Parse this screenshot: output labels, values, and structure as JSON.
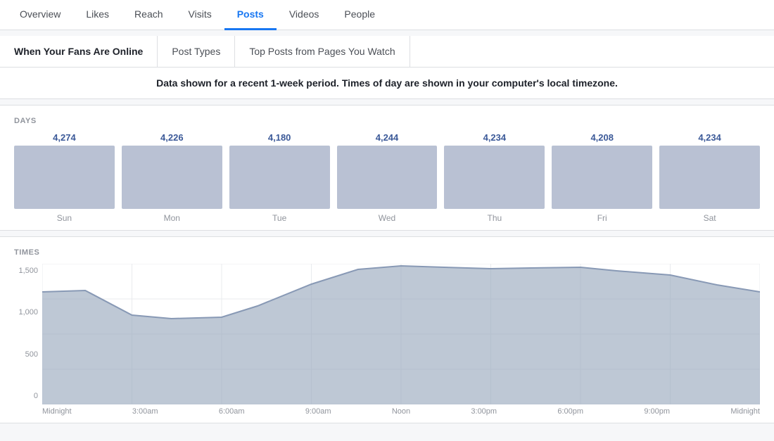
{
  "nav": {
    "tabs": [
      {
        "label": "Overview",
        "active": false
      },
      {
        "label": "Likes",
        "active": false
      },
      {
        "label": "Reach",
        "active": false
      },
      {
        "label": "Visits",
        "active": false
      },
      {
        "label": "Posts",
        "active": true
      },
      {
        "label": "Videos",
        "active": false
      },
      {
        "label": "People",
        "active": false
      }
    ]
  },
  "sub_nav": {
    "items": [
      {
        "label": "When Your Fans Are Online",
        "active": true
      },
      {
        "label": "Post Types",
        "active": false
      },
      {
        "label": "Top Posts from Pages You Watch",
        "active": false
      }
    ]
  },
  "info_bar": {
    "text": "Data shown for a recent 1-week period. Times of day are shown in your computer's local timezone."
  },
  "days": {
    "label": "DAYS",
    "items": [
      {
        "day": "Sun",
        "value": "4,274"
      },
      {
        "day": "Mon",
        "value": "4,226"
      },
      {
        "day": "Tue",
        "value": "4,180"
      },
      {
        "day": "Wed",
        "value": "4,244"
      },
      {
        "day": "Thu",
        "value": "4,234"
      },
      {
        "day": "Fri",
        "value": "4,208"
      },
      {
        "day": "Sat",
        "value": "4,234"
      }
    ]
  },
  "times": {
    "label": "TIMES",
    "y_axis": [
      "1,500",
      "1,000",
      "500",
      "0"
    ],
    "x_axis": [
      "Midnight",
      "3:00am",
      "6:00am",
      "9:00am",
      "Noon",
      "3:00pm",
      "6:00pm",
      "9:00pm",
      "Midnight"
    ]
  }
}
